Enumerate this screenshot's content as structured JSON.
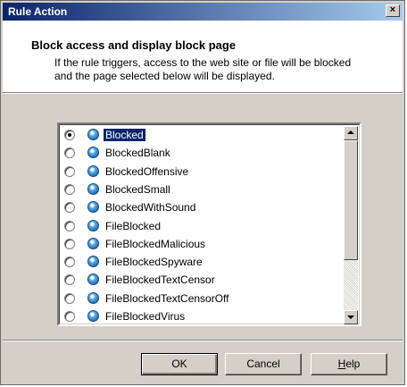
{
  "window": {
    "title": "Rule Action",
    "close_label": "×"
  },
  "header": {
    "title": "Block access and display block page",
    "description": "If the rule triggers, access to the web site or file will be blocked and the page selected below will be displayed."
  },
  "block_pages": [
    {
      "label": "Blocked",
      "selected": true
    },
    {
      "label": "BlockedBlank",
      "selected": false
    },
    {
      "label": "BlockedOffensive",
      "selected": false
    },
    {
      "label": "BlockedSmall",
      "selected": false
    },
    {
      "label": "BlockedWithSound",
      "selected": false
    },
    {
      "label": "FileBlocked",
      "selected": false
    },
    {
      "label": "FileBlockedMalicious",
      "selected": false
    },
    {
      "label": "FileBlockedSpyware",
      "selected": false
    },
    {
      "label": "FileBlockedTextCensor",
      "selected": false
    },
    {
      "label": "FileBlockedTextCensorOff",
      "selected": false
    },
    {
      "label": "FileBlockedVirus",
      "selected": false
    },
    {
      "label": "",
      "selected": false
    }
  ],
  "buttons": {
    "ok": "OK",
    "cancel": "Cancel",
    "help_accel": "H",
    "help_rest": "elp"
  },
  "colors": {
    "selection": "#0a246a",
    "dialog_face": "#d4d0c8",
    "title_gradient_start": "#0a246a",
    "title_gradient_end": "#a6caf0"
  },
  "icons": {
    "page_item": "globe-page-icon",
    "scroll_up": "arrow-up-icon",
    "scroll_down": "arrow-down-icon"
  }
}
